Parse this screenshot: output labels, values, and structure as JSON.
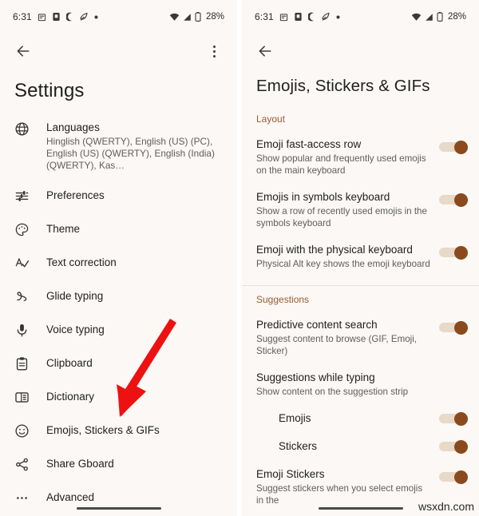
{
  "status_bar": {
    "time": "6:31",
    "battery_percent": "28%",
    "icons": [
      "calendar-icon",
      "sim-card-icon",
      "do-not-disturb-icon",
      "data-saver-icon",
      "dot-icon",
      "wifi-icon",
      "signal-icon",
      "battery-icon"
    ]
  },
  "left_screen": {
    "appbar": {
      "back_label": "←",
      "overflow_label": "More options"
    },
    "title": "Settings",
    "items": [
      {
        "icon": "globe-icon",
        "label": "Languages",
        "sub": "Hinglish (QWERTY), English (US) (PC), English (US) (QWERTY), English (India) (QWERTY), Kas…"
      },
      {
        "icon": "sliders-icon",
        "label": "Preferences",
        "sub": ""
      },
      {
        "icon": "palette-icon",
        "label": "Theme",
        "sub": ""
      },
      {
        "icon": "spellcheck-icon",
        "label": "Text correction",
        "sub": ""
      },
      {
        "icon": "glide-icon",
        "label": "Glide typing",
        "sub": ""
      },
      {
        "icon": "microphone-icon",
        "label": "Voice typing",
        "sub": ""
      },
      {
        "icon": "clipboard-icon",
        "label": "Clipboard",
        "sub": ""
      },
      {
        "icon": "dictionary-icon",
        "label": "Dictionary",
        "sub": ""
      },
      {
        "icon": "emoji-smiley-icon",
        "label": "Emojis, Stickers & GIFs",
        "sub": ""
      },
      {
        "icon": "share-icon",
        "label": "Share Gboard",
        "sub": ""
      },
      {
        "icon": "ellipsis-icon",
        "label": "Advanced",
        "sub": ""
      }
    ],
    "annotation": {
      "type": "red-arrow",
      "color": "#EE1111",
      "points_to": "Emojis, Stickers & GIFs"
    }
  },
  "right_screen": {
    "appbar": {
      "back_label": "←"
    },
    "title": "Emojis, Stickers & GIFs",
    "sections": [
      {
        "header": "Layout",
        "rows": [
          {
            "label": "Emoji fast-access row",
            "sub": "Show popular and frequently used emojis on the main keyboard",
            "toggle": "on",
            "indent": false
          },
          {
            "label": "Emojis in symbols keyboard",
            "sub": "Show a row of recently used emojis in the symbols keyboard",
            "toggle": "on",
            "indent": false
          },
          {
            "label": "Emoji with the physical keyboard",
            "sub": "Physical Alt key shows the emoji keyboard",
            "toggle": "on",
            "indent": false
          }
        ]
      },
      {
        "header": "Suggestions",
        "rows": [
          {
            "label": "Predictive content search",
            "sub": "Suggest content to browse (GIF, Emoji, Sticker)",
            "toggle": "on",
            "indent": false
          },
          {
            "label": "Suggestions while typing",
            "sub": "Show content on the suggestion strip",
            "toggle": "none",
            "indent": false
          },
          {
            "label": "Emojis",
            "sub": "",
            "toggle": "on",
            "indent": true
          },
          {
            "label": "Stickers",
            "sub": "",
            "toggle": "on",
            "indent": true
          },
          {
            "label": "Emoji Stickers",
            "sub": "Suggest stickers when you select emojis in the",
            "toggle": "on",
            "indent": false
          }
        ]
      }
    ]
  },
  "watermark": "wsxdn.com",
  "colors": {
    "background": "#FBF8F5",
    "section_header": "#9A5B32",
    "toggle_thumb": "#8A4A1E",
    "toggle_track": "#E8D9C8",
    "annotation_red": "#EE1111",
    "primary_text": "#1F1F1F",
    "secondary_text": "#5E5E5E"
  }
}
